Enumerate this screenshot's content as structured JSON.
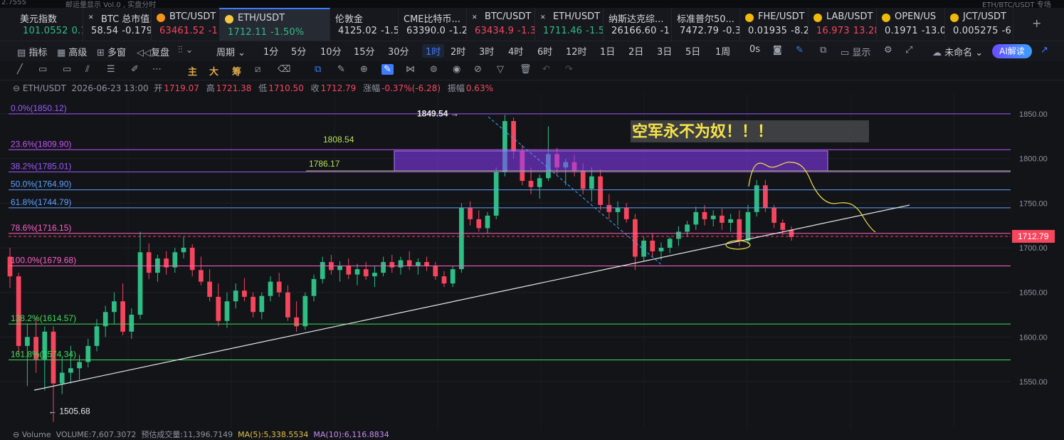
{
  "top_strip": {
    "left_text": "2.7555",
    "mid_text": "邮运量显示 Vol.0 , 实盘分时",
    "right_text": "ETH/BTC/USDT 专场"
  },
  "tickers": [
    {
      "name": "美元指数",
      "price": "101.0552",
      "change": "0.1",
      "dir": "up",
      "icon": "none"
    },
    {
      "name": "BTC 总市值...",
      "price": "58.54",
      "change": "-0.179",
      "dir": "neutral",
      "icon": "x-icon"
    },
    {
      "name": "BTC/USDT",
      "price": "63461.52",
      "change": "-1",
      "dir": "down",
      "icon": "btc-coin-icon"
    },
    {
      "name": "ETH/USDT",
      "price": "1712.11",
      "change": "-1.50%",
      "dir": "up",
      "icon": "eth-coin-icon",
      "active": true
    },
    {
      "name": "伦敦金",
      "price": "4125.02",
      "change": "-1.5",
      "dir": "neutral",
      "icon": "none"
    },
    {
      "name": "CME比特币...",
      "price": "63390.0",
      "change": "-1.2",
      "dir": "neutral",
      "icon": "none"
    },
    {
      "name": "BTC/USDT",
      "price": "63434.9",
      "change": "-1.3",
      "dir": "down",
      "icon": "x-icon"
    },
    {
      "name": "ETH/USDT",
      "price": "1711.46",
      "change": "-1.5",
      "dir": "up",
      "icon": "x-icon"
    },
    {
      "name": "纳斯达克综...",
      "price": "26166.60",
      "change": "-1",
      "dir": "neutral",
      "icon": "none"
    },
    {
      "name": "标准普尔50...",
      "price": "7472.79",
      "change": "-0.3",
      "dir": "neutral",
      "icon": "none"
    },
    {
      "name": "FHE/USDT",
      "price": "0.01935",
      "change": "-8.2",
      "dir": "neutral",
      "icon": "coin-icon"
    },
    {
      "name": "LAB/USDT",
      "price": "16.973",
      "change": "13.28",
      "dir": "down",
      "icon": "coin-icon"
    },
    {
      "name": "OPEN/US",
      "price": "0.1971",
      "change": "-13.0",
      "dir": "neutral",
      "icon": "coin-icon"
    },
    {
      "name": "JCT/USDT",
      "price": "0.005275",
      "change": "-6",
      "dir": "neutral",
      "icon": "coin-icon"
    }
  ],
  "toolbar": {
    "indicators": "指标",
    "advanced": "高级",
    "multi_window": "多窗",
    "replay": "复盘",
    "period": "周期",
    "timeframes": [
      "1分",
      "5分",
      "10分",
      "15分",
      "30分",
      "1时",
      "2时",
      "3时",
      "4时",
      "6时",
      "12时",
      "1日",
      "2日",
      "3日",
      "5日",
      "1周",
      "0s"
    ],
    "selected_timeframe": "1时",
    "display": "显示",
    "unnamed": "未命名",
    "ai": "AI解读"
  },
  "drawing_tools": {
    "main": "主",
    "big": "大",
    "chips": "筹"
  },
  "info_line": {
    "symbol": "ETH/USDT",
    "datetime": "2026-06-23 13:00",
    "open_label": "开",
    "open": "1719.07",
    "high_label": "高",
    "high": "1721.38",
    "low_label": "低",
    "low": "1710.50",
    "close_label": "收",
    "close": "1712.79",
    "change_label": "涨幅",
    "change": "-0.37%(-6.28)",
    "amplitude_label": "振幅",
    "amplitude": "0.63%"
  },
  "chart_data": {
    "type": "candlestick",
    "symbol": "ETH/USDT",
    "timeframe": "1h",
    "y_axis": {
      "ticks": [
        1550,
        1600,
        1650,
        1700,
        1750,
        1800,
        1850
      ],
      "labels": [
        "1550.00",
        "1600.00",
        "1650.00",
        "1700.00",
        "1750.00",
        "1800.00",
        "1850.00"
      ],
      "range": [
        1505,
        1860
      ]
    },
    "last_price": 1712.79,
    "last_price_label": "1712.79",
    "swing_high": 1849.54,
    "swing_high_label": "1849.54",
    "swing_low": 1505.68,
    "swing_low_label": "1505.68",
    "fib_levels": [
      {
        "label": "0.0%(1850.12)",
        "price": 1850.12,
        "color": "#9b59ff"
      },
      {
        "label": "23.6%(1809.90)",
        "price": 1809.9,
        "color": "#c255ff"
      },
      {
        "label": "38.2%(1785.01)",
        "price": 1785.01,
        "color": "#9b59ff"
      },
      {
        "label": "50.0%(1764.90)",
        "price": 1764.9,
        "color": "#5aa0ff"
      },
      {
        "label": "61.8%(1744.79)",
        "price": 1744.79,
        "color": "#5aa0ff"
      },
      {
        "label": "78.6%(1716.15)",
        "price": 1716.15,
        "color": "#ff5fc8"
      },
      {
        "label": "100.0%(1679.68)",
        "price": 1679.68,
        "color": "#ff5fc8"
      },
      {
        "label": "138.2%(1614.57)",
        "price": 1614.57,
        "color": "#3fdc5a"
      },
      {
        "label": "161.8%(1574.34)",
        "price": 1574.34,
        "color": "#3fdc5a"
      }
    ],
    "resistance_zone": {
      "from": 1786.17,
      "to": 1808.54,
      "label_low": "1786.17",
      "label_high": "1808.54"
    },
    "annotation_text": "空军永不为奴！！！",
    "candles": [
      [
        1690,
        1700,
        1655,
        1668
      ],
      [
        1668,
        1672,
        1580,
        1590
      ],
      [
        1590,
        1615,
        1545,
        1600
      ],
      [
        1600,
        1622,
        1560,
        1575
      ],
      [
        1575,
        1612,
        1540,
        1606
      ],
      [
        1606,
        1612,
        1505,
        1548
      ],
      [
        1548,
        1578,
        1536,
        1560
      ],
      [
        1560,
        1590,
        1548,
        1565
      ],
      [
        1565,
        1580,
        1552,
        1572
      ],
      [
        1572,
        1598,
        1566,
        1590
      ],
      [
        1590,
        1620,
        1584,
        1612
      ],
      [
        1612,
        1635,
        1600,
        1628
      ],
      [
        1628,
        1650,
        1615,
        1640
      ],
      [
        1640,
        1660,
        1602,
        1606
      ],
      [
        1606,
        1632,
        1598,
        1625
      ],
      [
        1625,
        1718,
        1620,
        1695
      ],
      [
        1695,
        1705,
        1665,
        1672
      ],
      [
        1672,
        1692,
        1662,
        1688
      ],
      [
        1688,
        1696,
        1670,
        1678
      ],
      [
        1678,
        1700,
        1672,
        1695
      ],
      [
        1695,
        1712,
        1688,
        1700
      ],
      [
        1700,
        1704,
        1668,
        1675
      ],
      [
        1675,
        1690,
        1658,
        1662
      ],
      [
        1662,
        1676,
        1640,
        1645
      ],
      [
        1645,
        1660,
        1612,
        1618
      ],
      [
        1618,
        1650,
        1610,
        1640
      ],
      [
        1640,
        1660,
        1632,
        1652
      ],
      [
        1652,
        1666,
        1640,
        1645
      ],
      [
        1645,
        1650,
        1622,
        1628
      ],
      [
        1628,
        1650,
        1620,
        1646
      ],
      [
        1646,
        1668,
        1640,
        1662
      ],
      [
        1662,
        1672,
        1645,
        1650
      ],
      [
        1650,
        1658,
        1618,
        1622
      ],
      [
        1622,
        1640,
        1606,
        1612
      ],
      [
        1612,
        1650,
        1608,
        1646
      ],
      [
        1646,
        1670,
        1640,
        1665
      ],
      [
        1665,
        1690,
        1660,
        1684
      ],
      [
        1684,
        1692,
        1670,
        1675
      ],
      [
        1675,
        1685,
        1662,
        1680
      ],
      [
        1680,
        1688,
        1665,
        1670
      ],
      [
        1670,
        1682,
        1658,
        1676
      ],
      [
        1676,
        1684,
        1664,
        1668
      ],
      [
        1668,
        1680,
        1656,
        1672
      ],
      [
        1672,
        1690,
        1668,
        1684
      ],
      [
        1684,
        1692,
        1672,
        1678
      ],
      [
        1678,
        1690,
        1670,
        1686
      ],
      [
        1686,
        1696,
        1675,
        1680
      ],
      [
        1680,
        1688,
        1670,
        1684
      ],
      [
        1684,
        1690,
        1674,
        1680
      ],
      [
        1680,
        1684,
        1664,
        1668
      ],
      [
        1668,
        1674,
        1656,
        1660
      ],
      [
        1660,
        1680,
        1656,
        1676
      ],
      [
        1676,
        1750,
        1672,
        1745
      ],
      [
        1745,
        1752,
        1725,
        1732
      ],
      [
        1732,
        1742,
        1718,
        1722
      ],
      [
        1722,
        1740,
        1716,
        1736
      ],
      [
        1736,
        1790,
        1732,
        1785
      ],
      [
        1785,
        1849,
        1780,
        1842
      ],
      [
        1842,
        1846,
        1800,
        1808
      ],
      [
        1808,
        1815,
        1770,
        1775
      ],
      [
        1775,
        1790,
        1760,
        1768
      ],
      [
        1768,
        1782,
        1755,
        1778
      ],
      [
        1778,
        1836,
        1775,
        1805
      ],
      [
        1805,
        1812,
        1782,
        1790
      ],
      [
        1790,
        1800,
        1770,
        1796
      ],
      [
        1796,
        1804,
        1780,
        1786
      ],
      [
        1786,
        1795,
        1760,
        1766
      ],
      [
        1766,
        1790,
        1752,
        1780
      ],
      [
        1780,
        1788,
        1742,
        1748
      ],
      [
        1748,
        1760,
        1732,
        1740
      ],
      [
        1740,
        1752,
        1725,
        1745
      ],
      [
        1745,
        1750,
        1728,
        1732
      ],
      [
        1732,
        1738,
        1675,
        1690
      ],
      [
        1690,
        1712,
        1685,
        1708
      ],
      [
        1708,
        1716,
        1690,
        1696
      ],
      [
        1696,
        1706,
        1686,
        1700
      ],
      [
        1700,
        1712,
        1694,
        1710
      ],
      [
        1710,
        1724,
        1702,
        1718
      ],
      [
        1718,
        1730,
        1712,
        1726
      ],
      [
        1726,
        1746,
        1720,
        1740
      ],
      [
        1740,
        1748,
        1725,
        1732
      ],
      [
        1732,
        1742,
        1724,
        1736
      ],
      [
        1736,
        1744,
        1720,
        1728
      ],
      [
        1728,
        1738,
        1718,
        1732
      ],
      [
        1732,
        1742,
        1702,
        1708
      ],
      [
        1708,
        1748,
        1704,
        1740
      ],
      [
        1740,
        1776,
        1735,
        1770
      ],
      [
        1770,
        1776,
        1740,
        1745
      ],
      [
        1745,
        1748,
        1722,
        1728
      ],
      [
        1728,
        1732,
        1714,
        1720
      ],
      [
        1720,
        1724,
        1708,
        1712
      ]
    ]
  },
  "volume_line": {
    "label": "Volume",
    "volume_label": "VOLUME:",
    "volume": "7,607.3072",
    "est_label": "预估成交量:",
    "est": "11,396.7149",
    "ma5_label": "MA(5):",
    "ma5": "5,338.5534",
    "ma10_label": "MA(10):",
    "ma10": "6,116.8834"
  }
}
